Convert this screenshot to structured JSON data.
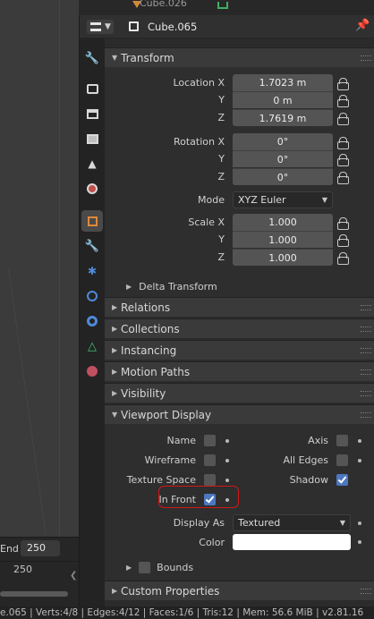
{
  "outliner": {
    "partial_name": "Cube.026"
  },
  "header": {
    "object_name": "Cube.065"
  },
  "tabs": [
    {
      "name": "tool-tab",
      "icon": "tool-icon"
    },
    {
      "name": "render-tab",
      "icon": "render-icon"
    },
    {
      "name": "output-tab",
      "icon": "output-icon"
    },
    {
      "name": "view-layer-tab",
      "icon": "view-layer-icon"
    },
    {
      "name": "scene-tab",
      "icon": "scene-icon"
    },
    {
      "name": "world-tab",
      "icon": "world-icon"
    },
    {
      "name": "object-tab",
      "icon": "object-icon",
      "active": true
    },
    {
      "name": "modifiers-tab",
      "icon": "wrench-icon"
    },
    {
      "name": "particles-tab",
      "icon": "particles-icon"
    },
    {
      "name": "physics-tab",
      "icon": "physics-icon"
    },
    {
      "name": "constraints-tab",
      "icon": "constraints-icon"
    },
    {
      "name": "data-tab",
      "icon": "mesh-data-icon"
    },
    {
      "name": "material-tab",
      "icon": "material-icon"
    }
  ],
  "transform": {
    "title": "Transform",
    "location": {
      "label_x": "Location X",
      "label_y": "Y",
      "label_z": "Z",
      "x": "1.7023 m",
      "y": "0 m",
      "z": "1.7619 m"
    },
    "rotation": {
      "label_x": "Rotation X",
      "label_y": "Y",
      "label_z": "Z",
      "x": "0°",
      "y": "0°",
      "z": "0°"
    },
    "mode": {
      "label": "Mode",
      "value": "XYZ Euler"
    },
    "scale": {
      "label_x": "Scale X",
      "label_y": "Y",
      "label_z": "Z",
      "x": "1.000",
      "y": "1.000",
      "z": "1.000"
    },
    "delta": "Delta Transform"
  },
  "panels": {
    "relations": "Relations",
    "collections": "Collections",
    "instancing": "Instancing",
    "motion_paths": "Motion Paths",
    "visibility": "Visibility",
    "viewport_display": "Viewport Display",
    "custom_properties": "Custom Properties"
  },
  "viewport_display": {
    "name": "Name",
    "axis": "Axis",
    "wireframe": "Wireframe",
    "all_edges": "All Edges",
    "texture_space": "Texture Space",
    "shadow": "Shadow",
    "in_front": "In Front",
    "display_as_label": "Display As",
    "display_as_value": "Textured",
    "color_label": "Color",
    "bounds": "Bounds",
    "shadow_checked": true,
    "in_front_checked": true,
    "highlight_color": "#d01818"
  },
  "timeline": {
    "end_label": "End",
    "end_value": "250",
    "frame_marker": "250"
  },
  "statusbar": {
    "text": "e.065 | Verts:4/8 | Edges:4/12 | Faces:1/6 | Tris:12 | Mem: 56.6 MiB | v2.81.16"
  },
  "colors": {
    "accent": "#4c78c0",
    "panel": "#3a3a3a",
    "field": "#545454"
  }
}
